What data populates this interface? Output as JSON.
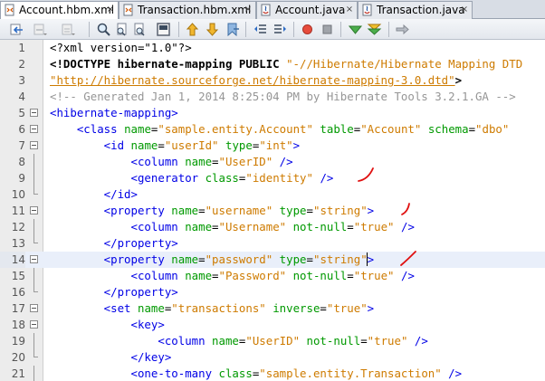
{
  "tabs": [
    {
      "label": "Account.hbm.xml",
      "icon": "xml-file-icon",
      "active": true
    },
    {
      "label": "Transaction.hbm.xml",
      "icon": "xml-file-icon",
      "active": false
    },
    {
      "label": "Account.java",
      "icon": "java-file-icon",
      "active": false
    },
    {
      "label": "Transaction.java",
      "icon": "java-file-icon",
      "active": false
    }
  ],
  "tab_close_glyph": "×",
  "toolbar": {
    "buttons": [
      "back-icon",
      "forward-disabled-icon",
      "last-edit-icon",
      "find-selection-icon",
      "find-previous-icon",
      "find-next-icon",
      "toggle-highlight-icon",
      "previous-bookmark-icon",
      "next-bookmark-icon",
      "toggle-bookmark-icon",
      "shift-left-icon",
      "shift-right-icon",
      "start-macro-icon",
      "stop-macro-icon",
      "check-xml-icon",
      "validate-xml-icon",
      "xsl-transform-icon"
    ]
  },
  "editor": {
    "current_line": 14,
    "lines": [
      {
        "n": "1",
        "tokens": [
          {
            "t": "punc",
            "s": "<?xml version=\"1.0\"?>"
          }
        ]
      },
      {
        "n": "2",
        "tokens": [
          {
            "t": "decl",
            "s": "<!DOCTYPE hibernate-mapping PUBLIC "
          },
          {
            "t": "str",
            "s": "\"-//Hibernate/Hibernate Mapping DTD"
          }
        ]
      },
      {
        "n": "3",
        "tokens": [
          {
            "t": "link",
            "s": "\"http://hibernate.sourceforge.net/hibernate-mapping-3.0.dtd\""
          },
          {
            "t": "decl",
            "s": ">"
          }
        ]
      },
      {
        "n": "4",
        "tokens": [
          {
            "t": "cmt",
            "s": "<!-- Generated Jan 1, 2014 8:25:04 PM by Hibernate Tools 3.2.1.GA -->"
          }
        ]
      },
      {
        "n": "5",
        "tokens": [
          {
            "t": "tag",
            "s": "<hibernate-mapping>"
          }
        ]
      },
      {
        "n": "6",
        "tokens": [
          {
            "t": "tag",
            "s": "    <class "
          },
          {
            "t": "attr",
            "s": "name"
          },
          {
            "t": "punc",
            "s": "="
          },
          {
            "t": "val",
            "s": "\"sample.entity.Account\""
          },
          {
            "t": "punc",
            "s": " "
          },
          {
            "t": "attr",
            "s": "table"
          },
          {
            "t": "punc",
            "s": "="
          },
          {
            "t": "val",
            "s": "\"Account\""
          },
          {
            "t": "punc",
            "s": " "
          },
          {
            "t": "attr",
            "s": "schema"
          },
          {
            "t": "punc",
            "s": "="
          },
          {
            "t": "val",
            "s": "\"dbo\""
          }
        ]
      },
      {
        "n": "7",
        "tokens": [
          {
            "t": "tag",
            "s": "        <id "
          },
          {
            "t": "attr",
            "s": "name"
          },
          {
            "t": "punc",
            "s": "="
          },
          {
            "t": "val",
            "s": "\"userId\""
          },
          {
            "t": "punc",
            "s": " "
          },
          {
            "t": "attr",
            "s": "type"
          },
          {
            "t": "punc",
            "s": "="
          },
          {
            "t": "val",
            "s": "\"int\""
          },
          {
            "t": "tag",
            "s": ">"
          }
        ]
      },
      {
        "n": "8",
        "tokens": [
          {
            "t": "tag",
            "s": "            <column "
          },
          {
            "t": "attr",
            "s": "name"
          },
          {
            "t": "punc",
            "s": "="
          },
          {
            "t": "val",
            "s": "\"UserID\""
          },
          {
            "t": "punc",
            "s": " "
          },
          {
            "t": "tag",
            "s": "/>"
          }
        ]
      },
      {
        "n": "9",
        "tokens": [
          {
            "t": "tag",
            "s": "            <generator "
          },
          {
            "t": "attr",
            "s": "class"
          },
          {
            "t": "punc",
            "s": "="
          },
          {
            "t": "val",
            "s": "\"identity\""
          },
          {
            "t": "punc",
            "s": " "
          },
          {
            "t": "tag",
            "s": "/>"
          }
        ]
      },
      {
        "n": "10",
        "tokens": [
          {
            "t": "tag",
            "s": "        </id>"
          }
        ]
      },
      {
        "n": "11",
        "tokens": [
          {
            "t": "tag",
            "s": "        <property "
          },
          {
            "t": "attr",
            "s": "name"
          },
          {
            "t": "punc",
            "s": "="
          },
          {
            "t": "val",
            "s": "\"username\""
          },
          {
            "t": "punc",
            "s": " "
          },
          {
            "t": "attr",
            "s": "type"
          },
          {
            "t": "punc",
            "s": "="
          },
          {
            "t": "val",
            "s": "\"string\""
          },
          {
            "t": "tag",
            "s": ">"
          }
        ]
      },
      {
        "n": "12",
        "tokens": [
          {
            "t": "tag",
            "s": "            <column "
          },
          {
            "t": "attr",
            "s": "name"
          },
          {
            "t": "punc",
            "s": "="
          },
          {
            "t": "val",
            "s": "\"Username\""
          },
          {
            "t": "punc",
            "s": " "
          },
          {
            "t": "attr",
            "s": "not-null"
          },
          {
            "t": "punc",
            "s": "="
          },
          {
            "t": "val",
            "s": "\"true\""
          },
          {
            "t": "punc",
            "s": " "
          },
          {
            "t": "tag",
            "s": "/>"
          }
        ]
      },
      {
        "n": "13",
        "tokens": [
          {
            "t": "tag",
            "s": "        </property>"
          }
        ]
      },
      {
        "n": "14",
        "tokens": [
          {
            "t": "tag",
            "s": "        <property "
          },
          {
            "t": "attr",
            "s": "name"
          },
          {
            "t": "punc",
            "s": "="
          },
          {
            "t": "val",
            "s": "\"password\""
          },
          {
            "t": "punc",
            "s": " "
          },
          {
            "t": "attr",
            "s": "type"
          },
          {
            "t": "punc",
            "s": "="
          },
          {
            "t": "val",
            "s": "\"string\""
          },
          {
            "t": "caret",
            "s": ""
          },
          {
            "t": "tag",
            "s": ">"
          }
        ]
      },
      {
        "n": "15",
        "tokens": [
          {
            "t": "tag",
            "s": "            <column "
          },
          {
            "t": "attr",
            "s": "name"
          },
          {
            "t": "punc",
            "s": "="
          },
          {
            "t": "val",
            "s": "\"Password\""
          },
          {
            "t": "punc",
            "s": " "
          },
          {
            "t": "attr",
            "s": "not-null"
          },
          {
            "t": "punc",
            "s": "="
          },
          {
            "t": "val",
            "s": "\"true\""
          },
          {
            "t": "punc",
            "s": " "
          },
          {
            "t": "tag",
            "s": "/>"
          }
        ]
      },
      {
        "n": "16",
        "tokens": [
          {
            "t": "tag",
            "s": "        </property>"
          }
        ]
      },
      {
        "n": "17",
        "tokens": [
          {
            "t": "tag",
            "s": "        <set "
          },
          {
            "t": "attr",
            "s": "name"
          },
          {
            "t": "punc",
            "s": "="
          },
          {
            "t": "val",
            "s": "\"transactions\""
          },
          {
            "t": "punc",
            "s": " "
          },
          {
            "t": "attr",
            "s": "inverse"
          },
          {
            "t": "punc",
            "s": "="
          },
          {
            "t": "val",
            "s": "\"true\""
          },
          {
            "t": "tag",
            "s": ">"
          }
        ]
      },
      {
        "n": "18",
        "tokens": [
          {
            "t": "tag",
            "s": "            <key>"
          }
        ]
      },
      {
        "n": "19",
        "tokens": [
          {
            "t": "tag",
            "s": "                <column "
          },
          {
            "t": "attr",
            "s": "name"
          },
          {
            "t": "punc",
            "s": "="
          },
          {
            "t": "val",
            "s": "\"UserID\""
          },
          {
            "t": "punc",
            "s": " "
          },
          {
            "t": "attr",
            "s": "not-null"
          },
          {
            "t": "punc",
            "s": "="
          },
          {
            "t": "val",
            "s": "\"true\""
          },
          {
            "t": "punc",
            "s": " "
          },
          {
            "t": "tag",
            "s": "/>"
          }
        ]
      },
      {
        "n": "20",
        "tokens": [
          {
            "t": "tag",
            "s": "            </key>"
          }
        ]
      },
      {
        "n": "21",
        "tokens": [
          {
            "t": "tag",
            "s": "            <one-to-many "
          },
          {
            "t": "attr",
            "s": "class"
          },
          {
            "t": "punc",
            "s": "="
          },
          {
            "t": "val",
            "s": "\"sample.entity.Transaction\""
          },
          {
            "t": "punc",
            "s": " "
          },
          {
            "t": "tag",
            "s": "/>"
          }
        ]
      }
    ]
  },
  "colors": {
    "tag": "#0000e6",
    "attribute": "#009900",
    "value": "#ce7b00",
    "comment": "#969696",
    "current_line": "#e9effa",
    "annotation": "#e01010"
  }
}
